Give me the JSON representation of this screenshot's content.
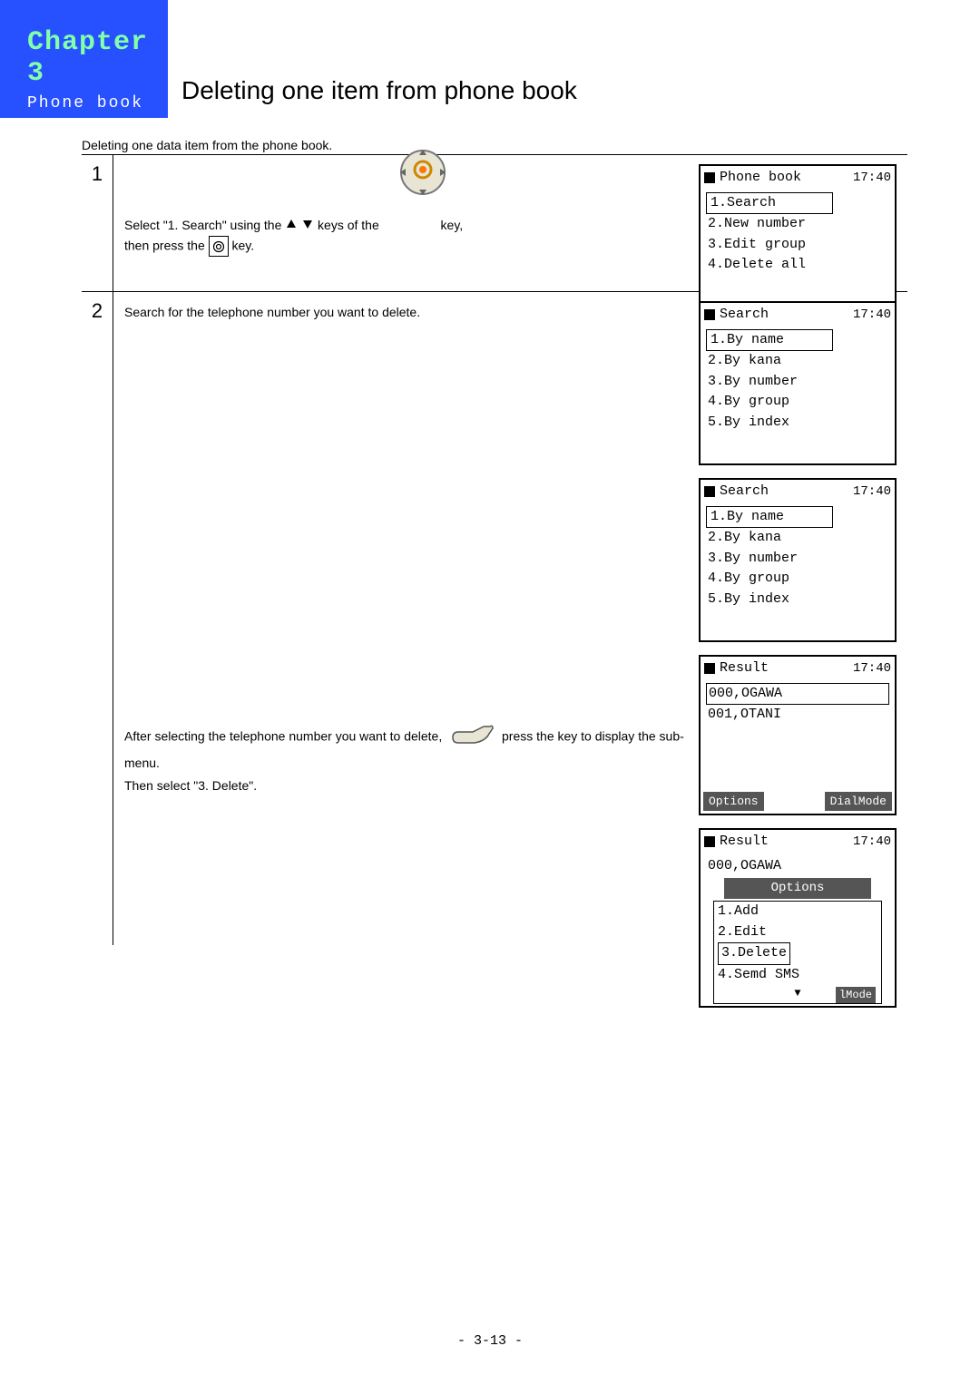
{
  "header": {
    "chapter": "Chapter 3",
    "subchapter": "Phone book",
    "title": "Deleting one item from phone book"
  },
  "intro": "Deleting one data item from the phone book.",
  "steps": {
    "s1": {
      "num": "1",
      "textA": "Select \"1. Search\" using the",
      "textB": "keys of the",
      "textC": "key,",
      "textD": "then press the",
      "textE": "key."
    },
    "s2": {
      "num": "2",
      "textA": "Search for the telephone number you want to delete.",
      "textB": "After selecting the telephone number you want to delete,",
      "textC": "press the  key to display the sub-menu.",
      "textD": "Then select \"3. Delete\"."
    }
  },
  "screens": {
    "time": "17:40",
    "phonebook": {
      "title": "Phone book",
      "items": [
        "1.Search",
        "2.New number",
        "3.Edit group",
        "4.Delete all"
      ]
    },
    "search": {
      "title": "Search",
      "items": [
        "1.By name",
        "2.By kana",
        "3.By number",
        "4.By group",
        "5.By index"
      ]
    },
    "result1": {
      "title": "Result",
      "items": [
        "000,OGAWA",
        "001,OTANI"
      ],
      "soft1": "Options",
      "soft2": "DialMode"
    },
    "result2": {
      "title": "Result",
      "top": "000,OGAWA",
      "popup_title": "Options",
      "popup_items": [
        "1.Add",
        "2.Edit",
        "3.Delete",
        "4.Semd SMS"
      ],
      "soft": "lMode"
    }
  },
  "page": "- 3-13 -"
}
